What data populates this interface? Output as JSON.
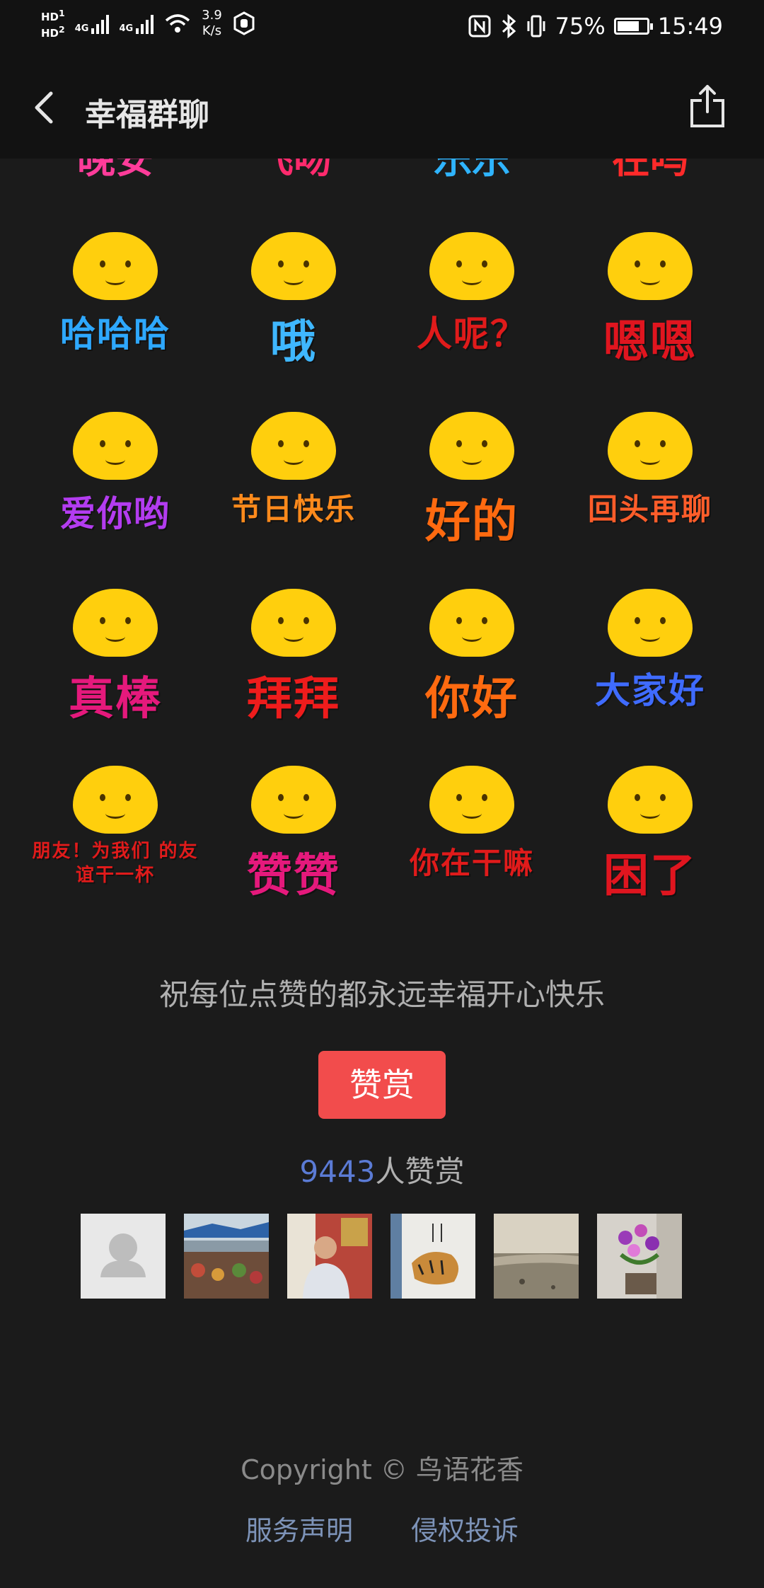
{
  "status_bar": {
    "hd1": "HD",
    "hd2": "HD",
    "net1": "4G",
    "net2": "4G",
    "speed_value": "3.9",
    "speed_unit": "K/s",
    "battery": "75%",
    "battery_level": 0.75,
    "time": "15:49",
    "icons": [
      "hd-icon",
      "signal-icon",
      "wifi-icon",
      "hand-icon",
      "nfc-icon",
      "bluetooth-icon",
      "vibrate-icon",
      "battery-icon"
    ]
  },
  "nav": {
    "title": "幸福群聊"
  },
  "stickers": {
    "partial_row": [
      "晚安",
      "飞吻",
      "乐乐",
      "在吗"
    ],
    "rows": [
      [
        {
          "text": "哈哈哈",
          "color": "#2ea8ff"
        },
        {
          "text": "哦",
          "color": "#3fb7ff"
        },
        {
          "text": "人呢？",
          "color": "#e01b1b"
        },
        {
          "text": "嗯嗯",
          "color": "#e0151f"
        }
      ],
      [
        {
          "text": "爱你哟",
          "color": "#b33cf0"
        },
        {
          "text": "节日快乐",
          "color": "#ff8a1c"
        },
        {
          "text": "好的",
          "color": "#ff6a10"
        },
        {
          "text": "回头再聊",
          "color": "#ff5d2a"
        }
      ],
      [
        {
          "text": "真棒",
          "color": "#e5197c"
        },
        {
          "text": "拜拜",
          "color": "#ee1c1c"
        },
        {
          "text": "你好",
          "color": "#ff6a10"
        },
        {
          "text": "大家好",
          "color": "#3f6bff"
        }
      ],
      [
        {
          "text": "朋友！为我们 的友谊干一杯",
          "color": "#e01b1b"
        },
        {
          "text": "赞赞",
          "color": "#e5197c"
        },
        {
          "text": "你在干嘛",
          "color": "#e01b1b"
        },
        {
          "text": "困了",
          "color": "#e0151f"
        }
      ]
    ]
  },
  "blessing": "祝每位点赞的都永远幸福开心快乐",
  "reward_button": "赞赏",
  "reward_count": {
    "number": "9443",
    "suffix": "人赞赏"
  },
  "avatars": [
    "default-avatar-icon",
    "market-photo",
    "person-photo",
    "tiger-painting-photo",
    "beach-photo",
    "flowers-photo"
  ],
  "footer": {
    "copyright": "Copyright © 鸟语花香",
    "links": [
      "服务声明",
      "侵权投诉"
    ]
  }
}
